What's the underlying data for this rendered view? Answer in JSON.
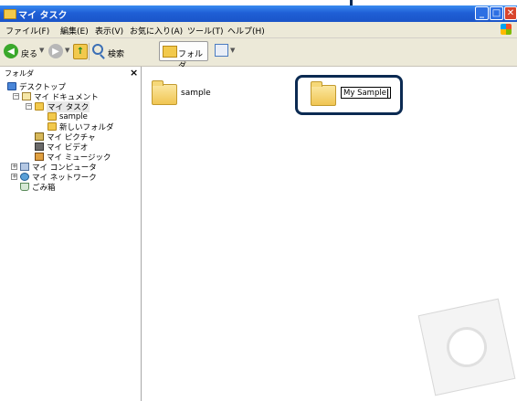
{
  "window": {
    "title": "マイ タスク"
  },
  "menu": [
    "ファイル(F)",
    "編集(E)",
    "表示(V)",
    "お気に入り(A)",
    "ツール(T)",
    "ヘルプ(H)"
  ],
  "toolbar": {
    "back_label": "戻る",
    "search_label": "検索",
    "folders_label": "フォルダ"
  },
  "folder_pane": {
    "title": "フォルダ",
    "close_glyph": "×",
    "items": [
      {
        "label": "デスクトップ",
        "icon": "desktop-icon"
      },
      {
        "label": "マイ ドキュメント",
        "icon": "my-documents-icon"
      },
      {
        "label": "マイ タスク",
        "icon": "folder-icon"
      },
      {
        "label": "sample",
        "icon": "folder-icon"
      },
      {
        "label": "新しいフォルダ",
        "icon": "folder-icon"
      },
      {
        "label": "マイ ピクチャ",
        "icon": "my-pictures-icon"
      },
      {
        "label": "マイ ビデオ",
        "icon": "my-videos-icon"
      },
      {
        "label": "マイ ミュージック",
        "icon": "my-music-icon"
      },
      {
        "label": "マイ コンピュータ",
        "icon": "my-computer-icon"
      },
      {
        "label": "マイ ネットワーク",
        "icon": "my-network-icon"
      },
      {
        "label": "ごみ箱",
        "icon": "recycle-bin-icon"
      }
    ]
  },
  "content": {
    "folders": [
      {
        "label": "sample"
      },
      {
        "label": "My Sample",
        "editing": true
      }
    ]
  },
  "colors": {
    "titlebar": "#1f5fd6",
    "callout": "#0b2a52",
    "chrome": "#ece9d8"
  }
}
